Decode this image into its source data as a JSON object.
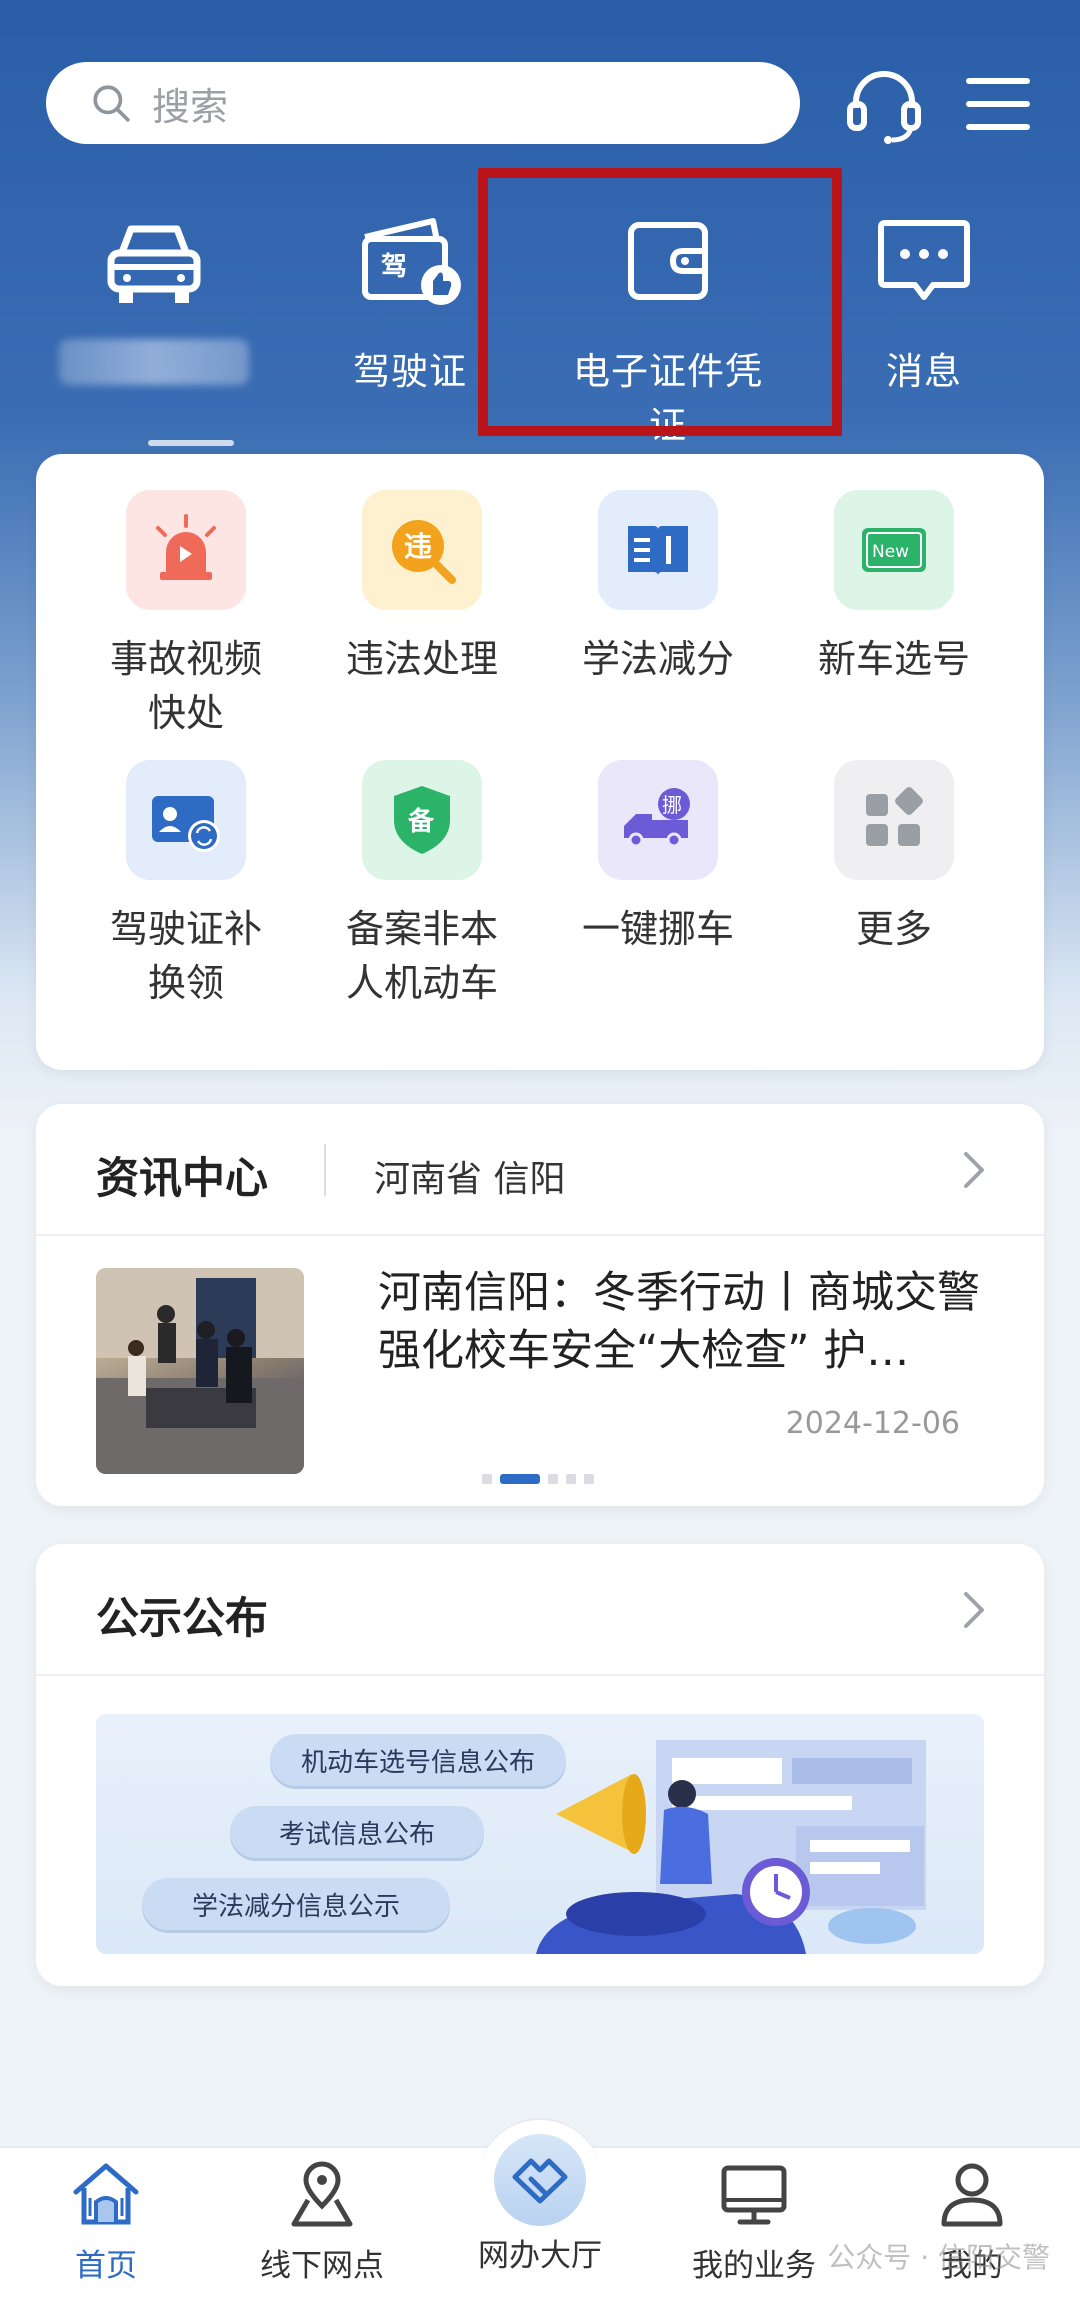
{
  "search": {
    "placeholder": "搜索"
  },
  "top_icons": [
    "headset-icon",
    "menu-icon"
  ],
  "quick_nav": {
    "items": [
      {
        "icon": "car-icon",
        "label": ""
      },
      {
        "icon": "driving-license-icon",
        "label": "驾驶证"
      },
      {
        "icon": "wallet-icon",
        "label": "电子证件凭证"
      },
      {
        "icon": "message-icon",
        "label": "消息"
      }
    ],
    "highlight_color": "#b8141a"
  },
  "services": [
    {
      "icon": "siren-icon",
      "label": "事故视频快处",
      "lines": [
        "事故视频",
        "快处"
      ],
      "color": "#f06a5a"
    },
    {
      "icon": "violation-icon",
      "label": "违法处理",
      "lines": [
        "违法处理"
      ],
      "color": "#f2a21d"
    },
    {
      "icon": "book-icon",
      "label": "学法减分",
      "lines": [
        "学法减分"
      ],
      "color": "#2d6bc4"
    },
    {
      "icon": "new-plate-icon",
      "label": "新车选号",
      "lines": [
        "新车选号"
      ],
      "color": "#2bb36a"
    },
    {
      "icon": "license-swap-icon",
      "label": "驾驶证补换领",
      "lines": [
        "驾驶证补",
        "换领"
      ],
      "color": "#2d6bc4"
    },
    {
      "icon": "shield-icon",
      "label": "备案非本人机动车",
      "lines": [
        "备案非本",
        "人机动车"
      ],
      "color": "#2bb36a"
    },
    {
      "icon": "tow-truck-icon",
      "label": "一键挪车",
      "lines": [
        "一键挪车"
      ],
      "color": "#6b5bd6"
    },
    {
      "icon": "more-grid-icon",
      "label": "更多",
      "lines": [
        "更多"
      ],
      "color": "#9a9ea5"
    }
  ],
  "news": {
    "title": "资讯中心",
    "region": "河南省 信阳",
    "headline": "河南信阳：冬季行动丨商城交警强化校车安全“大检查” 护…",
    "date": "2024-12-06",
    "carousel_active": 1,
    "carousel_count": 5
  },
  "notice": {
    "title": "公示公布",
    "pills": [
      "机动车选号信息公布",
      "考试信息公布",
      "学法减分信息公示"
    ]
  },
  "bottom_nav": [
    {
      "icon": "home-icon",
      "label": "首页",
      "active": true
    },
    {
      "icon": "location-icon",
      "label": "线下网点",
      "active": false
    },
    {
      "icon": "hall-icon",
      "label": "网办大厅",
      "active": false
    },
    {
      "icon": "monitor-icon",
      "label": "我的业务",
      "active": false
    },
    {
      "icon": "user-icon",
      "label": "我的",
      "active": false
    }
  ],
  "watermark": "公众号 · 信阳交警",
  "colors": {
    "primary": "#2d6bc4",
    "header_blue": "#2a5ea8"
  }
}
